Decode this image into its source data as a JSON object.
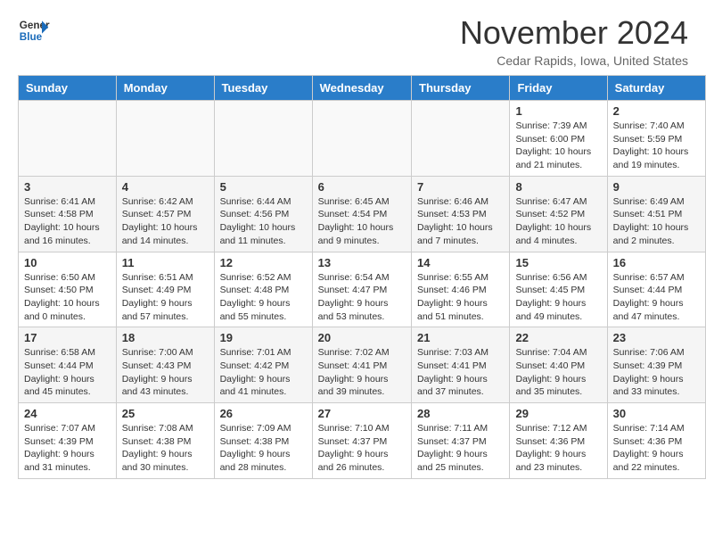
{
  "header": {
    "logo_line1": "General",
    "logo_line2": "Blue",
    "month_title": "November 2024",
    "location": "Cedar Rapids, Iowa, United States"
  },
  "days_of_week": [
    "Sunday",
    "Monday",
    "Tuesday",
    "Wednesday",
    "Thursday",
    "Friday",
    "Saturday"
  ],
  "weeks": [
    [
      {
        "day": "",
        "empty": true
      },
      {
        "day": "",
        "empty": true
      },
      {
        "day": "",
        "empty": true
      },
      {
        "day": "",
        "empty": true
      },
      {
        "day": "",
        "empty": true
      },
      {
        "day": "1",
        "sunrise": "Sunrise: 7:39 AM",
        "sunset": "Sunset: 6:00 PM",
        "daylight": "Daylight: 10 hours and 21 minutes."
      },
      {
        "day": "2",
        "sunrise": "Sunrise: 7:40 AM",
        "sunset": "Sunset: 5:59 PM",
        "daylight": "Daylight: 10 hours and 19 minutes."
      }
    ],
    [
      {
        "day": "3",
        "sunrise": "Sunrise: 6:41 AM",
        "sunset": "Sunset: 4:58 PM",
        "daylight": "Daylight: 10 hours and 16 minutes."
      },
      {
        "day": "4",
        "sunrise": "Sunrise: 6:42 AM",
        "sunset": "Sunset: 4:57 PM",
        "daylight": "Daylight: 10 hours and 14 minutes."
      },
      {
        "day": "5",
        "sunrise": "Sunrise: 6:44 AM",
        "sunset": "Sunset: 4:56 PM",
        "daylight": "Daylight: 10 hours and 11 minutes."
      },
      {
        "day": "6",
        "sunrise": "Sunrise: 6:45 AM",
        "sunset": "Sunset: 4:54 PM",
        "daylight": "Daylight: 10 hours and 9 minutes."
      },
      {
        "day": "7",
        "sunrise": "Sunrise: 6:46 AM",
        "sunset": "Sunset: 4:53 PM",
        "daylight": "Daylight: 10 hours and 7 minutes."
      },
      {
        "day": "8",
        "sunrise": "Sunrise: 6:47 AM",
        "sunset": "Sunset: 4:52 PM",
        "daylight": "Daylight: 10 hours and 4 minutes."
      },
      {
        "day": "9",
        "sunrise": "Sunrise: 6:49 AM",
        "sunset": "Sunset: 4:51 PM",
        "daylight": "Daylight: 10 hours and 2 minutes."
      }
    ],
    [
      {
        "day": "10",
        "sunrise": "Sunrise: 6:50 AM",
        "sunset": "Sunset: 4:50 PM",
        "daylight": "Daylight: 10 hours and 0 minutes."
      },
      {
        "day": "11",
        "sunrise": "Sunrise: 6:51 AM",
        "sunset": "Sunset: 4:49 PM",
        "daylight": "Daylight: 9 hours and 57 minutes."
      },
      {
        "day": "12",
        "sunrise": "Sunrise: 6:52 AM",
        "sunset": "Sunset: 4:48 PM",
        "daylight": "Daylight: 9 hours and 55 minutes."
      },
      {
        "day": "13",
        "sunrise": "Sunrise: 6:54 AM",
        "sunset": "Sunset: 4:47 PM",
        "daylight": "Daylight: 9 hours and 53 minutes."
      },
      {
        "day": "14",
        "sunrise": "Sunrise: 6:55 AM",
        "sunset": "Sunset: 4:46 PM",
        "daylight": "Daylight: 9 hours and 51 minutes."
      },
      {
        "day": "15",
        "sunrise": "Sunrise: 6:56 AM",
        "sunset": "Sunset: 4:45 PM",
        "daylight": "Daylight: 9 hours and 49 minutes."
      },
      {
        "day": "16",
        "sunrise": "Sunrise: 6:57 AM",
        "sunset": "Sunset: 4:44 PM",
        "daylight": "Daylight: 9 hours and 47 minutes."
      }
    ],
    [
      {
        "day": "17",
        "sunrise": "Sunrise: 6:58 AM",
        "sunset": "Sunset: 4:44 PM",
        "daylight": "Daylight: 9 hours and 45 minutes."
      },
      {
        "day": "18",
        "sunrise": "Sunrise: 7:00 AM",
        "sunset": "Sunset: 4:43 PM",
        "daylight": "Daylight: 9 hours and 43 minutes."
      },
      {
        "day": "19",
        "sunrise": "Sunrise: 7:01 AM",
        "sunset": "Sunset: 4:42 PM",
        "daylight": "Daylight: 9 hours and 41 minutes."
      },
      {
        "day": "20",
        "sunrise": "Sunrise: 7:02 AM",
        "sunset": "Sunset: 4:41 PM",
        "daylight": "Daylight: 9 hours and 39 minutes."
      },
      {
        "day": "21",
        "sunrise": "Sunrise: 7:03 AM",
        "sunset": "Sunset: 4:41 PM",
        "daylight": "Daylight: 9 hours and 37 minutes."
      },
      {
        "day": "22",
        "sunrise": "Sunrise: 7:04 AM",
        "sunset": "Sunset: 4:40 PM",
        "daylight": "Daylight: 9 hours and 35 minutes."
      },
      {
        "day": "23",
        "sunrise": "Sunrise: 7:06 AM",
        "sunset": "Sunset: 4:39 PM",
        "daylight": "Daylight: 9 hours and 33 minutes."
      }
    ],
    [
      {
        "day": "24",
        "sunrise": "Sunrise: 7:07 AM",
        "sunset": "Sunset: 4:39 PM",
        "daylight": "Daylight: 9 hours and 31 minutes."
      },
      {
        "day": "25",
        "sunrise": "Sunrise: 7:08 AM",
        "sunset": "Sunset: 4:38 PM",
        "daylight": "Daylight: 9 hours and 30 minutes."
      },
      {
        "day": "26",
        "sunrise": "Sunrise: 7:09 AM",
        "sunset": "Sunset: 4:38 PM",
        "daylight": "Daylight: 9 hours and 28 minutes."
      },
      {
        "day": "27",
        "sunrise": "Sunrise: 7:10 AM",
        "sunset": "Sunset: 4:37 PM",
        "daylight": "Daylight: 9 hours and 26 minutes."
      },
      {
        "day": "28",
        "sunrise": "Sunrise: 7:11 AM",
        "sunset": "Sunset: 4:37 PM",
        "daylight": "Daylight: 9 hours and 25 minutes."
      },
      {
        "day": "29",
        "sunrise": "Sunrise: 7:12 AM",
        "sunset": "Sunset: 4:36 PM",
        "daylight": "Daylight: 9 hours and 23 minutes."
      },
      {
        "day": "30",
        "sunrise": "Sunrise: 7:14 AM",
        "sunset": "Sunset: 4:36 PM",
        "daylight": "Daylight: 9 hours and 22 minutes."
      }
    ]
  ]
}
